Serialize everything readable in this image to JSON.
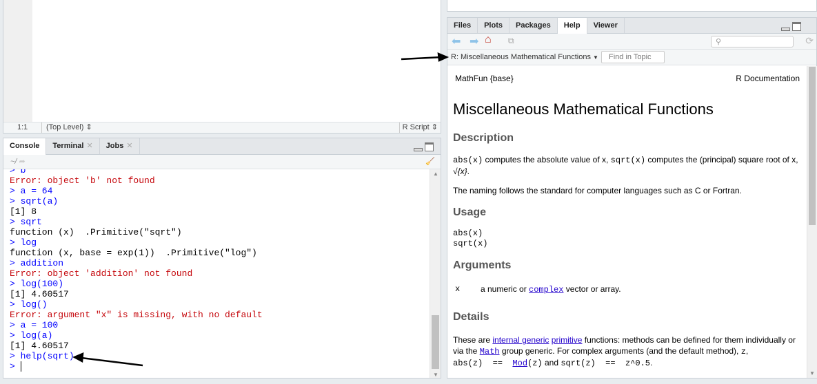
{
  "editor": {
    "position": "1:1",
    "scope": "(Top Level)",
    "file_type": "R Script"
  },
  "console": {
    "tabs": [
      {
        "label": "Console"
      },
      {
        "label": "Terminal"
      },
      {
        "label": "Jobs"
      }
    ],
    "path": "~/",
    "lines": [
      {
        "type": "cmd",
        "text": "> b"
      },
      {
        "type": "err",
        "text": "Error: object 'b' not found"
      },
      {
        "type": "cmd",
        "text": "> a = 64"
      },
      {
        "type": "cmd",
        "text": "> sqrt(a)"
      },
      {
        "type": "out",
        "text": "[1] 8"
      },
      {
        "type": "cmd",
        "text": "> sqrt"
      },
      {
        "type": "out",
        "text": "function (x)  .Primitive(\"sqrt\")"
      },
      {
        "type": "cmd",
        "text": "> log"
      },
      {
        "type": "out",
        "text": "function (x, base = exp(1))  .Primitive(\"log\")"
      },
      {
        "type": "cmd",
        "text": "> addition"
      },
      {
        "type": "err",
        "text": "Error: object 'addition' not found"
      },
      {
        "type": "cmd",
        "text": "> log(100)"
      },
      {
        "type": "out",
        "text": "[1] 4.60517"
      },
      {
        "type": "cmd",
        "text": "> log()"
      },
      {
        "type": "err",
        "text": "Error: argument \"x\" is missing, with no default"
      },
      {
        "type": "cmd",
        "text": "> a = 100"
      },
      {
        "type": "cmd",
        "text": "> log(a)"
      },
      {
        "type": "out",
        "text": "[1] 4.60517"
      },
      {
        "type": "cmd",
        "text": "> help(sqrt)"
      }
    ],
    "prompt": ">"
  },
  "right": {
    "tabs": [
      {
        "label": "Files"
      },
      {
        "label": "Plots"
      },
      {
        "label": "Packages"
      },
      {
        "label": "Help"
      },
      {
        "label": "Viewer"
      }
    ],
    "topic": "R: Miscellaneous Mathematical Functions",
    "find_placeholder": "Find in Topic",
    "help": {
      "pkg": "MathFun {base}",
      "doc": "R Documentation",
      "title": "Miscellaneous Mathematical Functions",
      "h_description": "Description",
      "desc1a": "abs(x)",
      "desc1b": " computes the absolute value of x, ",
      "desc1c": "sqrt(x)",
      "desc1d": " computes the (principal) square root of x, ",
      "desc1e": "√{x}",
      "desc2": "The naming follows the standard for computer languages such as C or Fortran.",
      "h_usage": "Usage",
      "usage1": "abs(x)",
      "usage2": "sqrt(x)",
      "h_arguments": "Arguments",
      "arg_name": "x",
      "arg_a": "a numeric or ",
      "arg_link": "complex",
      "arg_b": " vector or array.",
      "h_details": "Details",
      "d_a": "These are ",
      "d_l1": "internal generic",
      "d_l2": "primitive",
      "d_b": " functions: methods can be defined for them individually or via the ",
      "d_l3": "Math",
      "d_c": " group generic. For complex arguments (and the default method), ",
      "d_z": "z",
      "d_d": ", ",
      "d_abs": "abs(z)  ==  ",
      "d_l4": "Mod",
      "d_mod": "(z)",
      "d_e": " and ",
      "d_sqrt": "sqrt(z)  ==  z^0.5",
      "d_f": "."
    }
  }
}
